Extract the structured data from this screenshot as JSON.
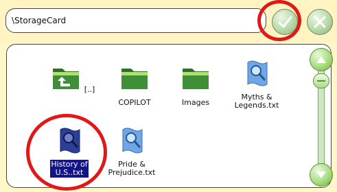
{
  "path": {
    "value": "\\StorageCard"
  },
  "buttons": {
    "ok": "ok-check-icon",
    "cancel": "cancel-x-icon"
  },
  "files": [
    {
      "label": "[..]",
      "icon": "folder-up-icon",
      "selected": false
    },
    {
      "label": "COPILOT",
      "icon": "folder-icon",
      "selected": false
    },
    {
      "label": "Images",
      "icon": "folder-icon",
      "selected": false
    },
    {
      "label": "Myths &\nLegends.txt",
      "icon": "text-file-icon",
      "selected": false
    },
    {
      "label": "History of\nU.S..txt",
      "icon": "text-file-icon",
      "selected": true
    },
    {
      "label": "Pride &\nPrejudice.txt",
      "icon": "text-file-icon",
      "selected": false
    }
  ],
  "colors": {
    "background": "#fff7c8",
    "selection": "#14148a",
    "highlight_circle": "#e01818",
    "button_green": "#a9de7f"
  }
}
